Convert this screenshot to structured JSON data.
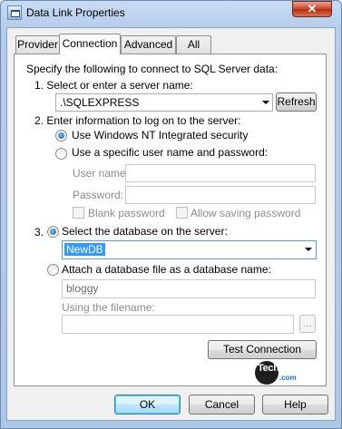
{
  "window": {
    "title": "Data Link Properties",
    "close_glyph": "✕"
  },
  "tabs": [
    {
      "label": "Provider"
    },
    {
      "label": "Connection"
    },
    {
      "label": "Advanced"
    },
    {
      "label": "All"
    }
  ],
  "intro": "Specify the following to connect to SQL Server data:",
  "step1": {
    "label": "1. Select or enter a server name:",
    "server_value": ".\\SQLEXPRESS",
    "refresh_label": "Refresh"
  },
  "step2": {
    "label": "2. Enter information to log on to the server:",
    "windows_auth_label": "Use Windows NT Integrated security",
    "specific_user_label": "Use a specific user name and password:",
    "username_label": "User name:",
    "password_label": "Password:",
    "blank_password_label": "Blank password",
    "allow_saving_label": "Allow saving password"
  },
  "step3": {
    "number": "3.",
    "select_db_label": "Select the database on the server:",
    "database_value": "NewDB",
    "attach_label": "Attach a database file as a database name:",
    "attach_value": "bloggy",
    "filename_label": "Using the filename:",
    "browse_label": "..."
  },
  "test_connection_label": "Test Connection",
  "watermark": {
    "main": "Techumber",
    "sub": ".com"
  },
  "footer": {
    "ok_label": "OK",
    "cancel_label": "Cancel",
    "help_label": "Help"
  },
  "colors": {
    "selection": "#3399ff",
    "title_bar": "#b6cde9",
    "close_button": "#c7432a"
  }
}
